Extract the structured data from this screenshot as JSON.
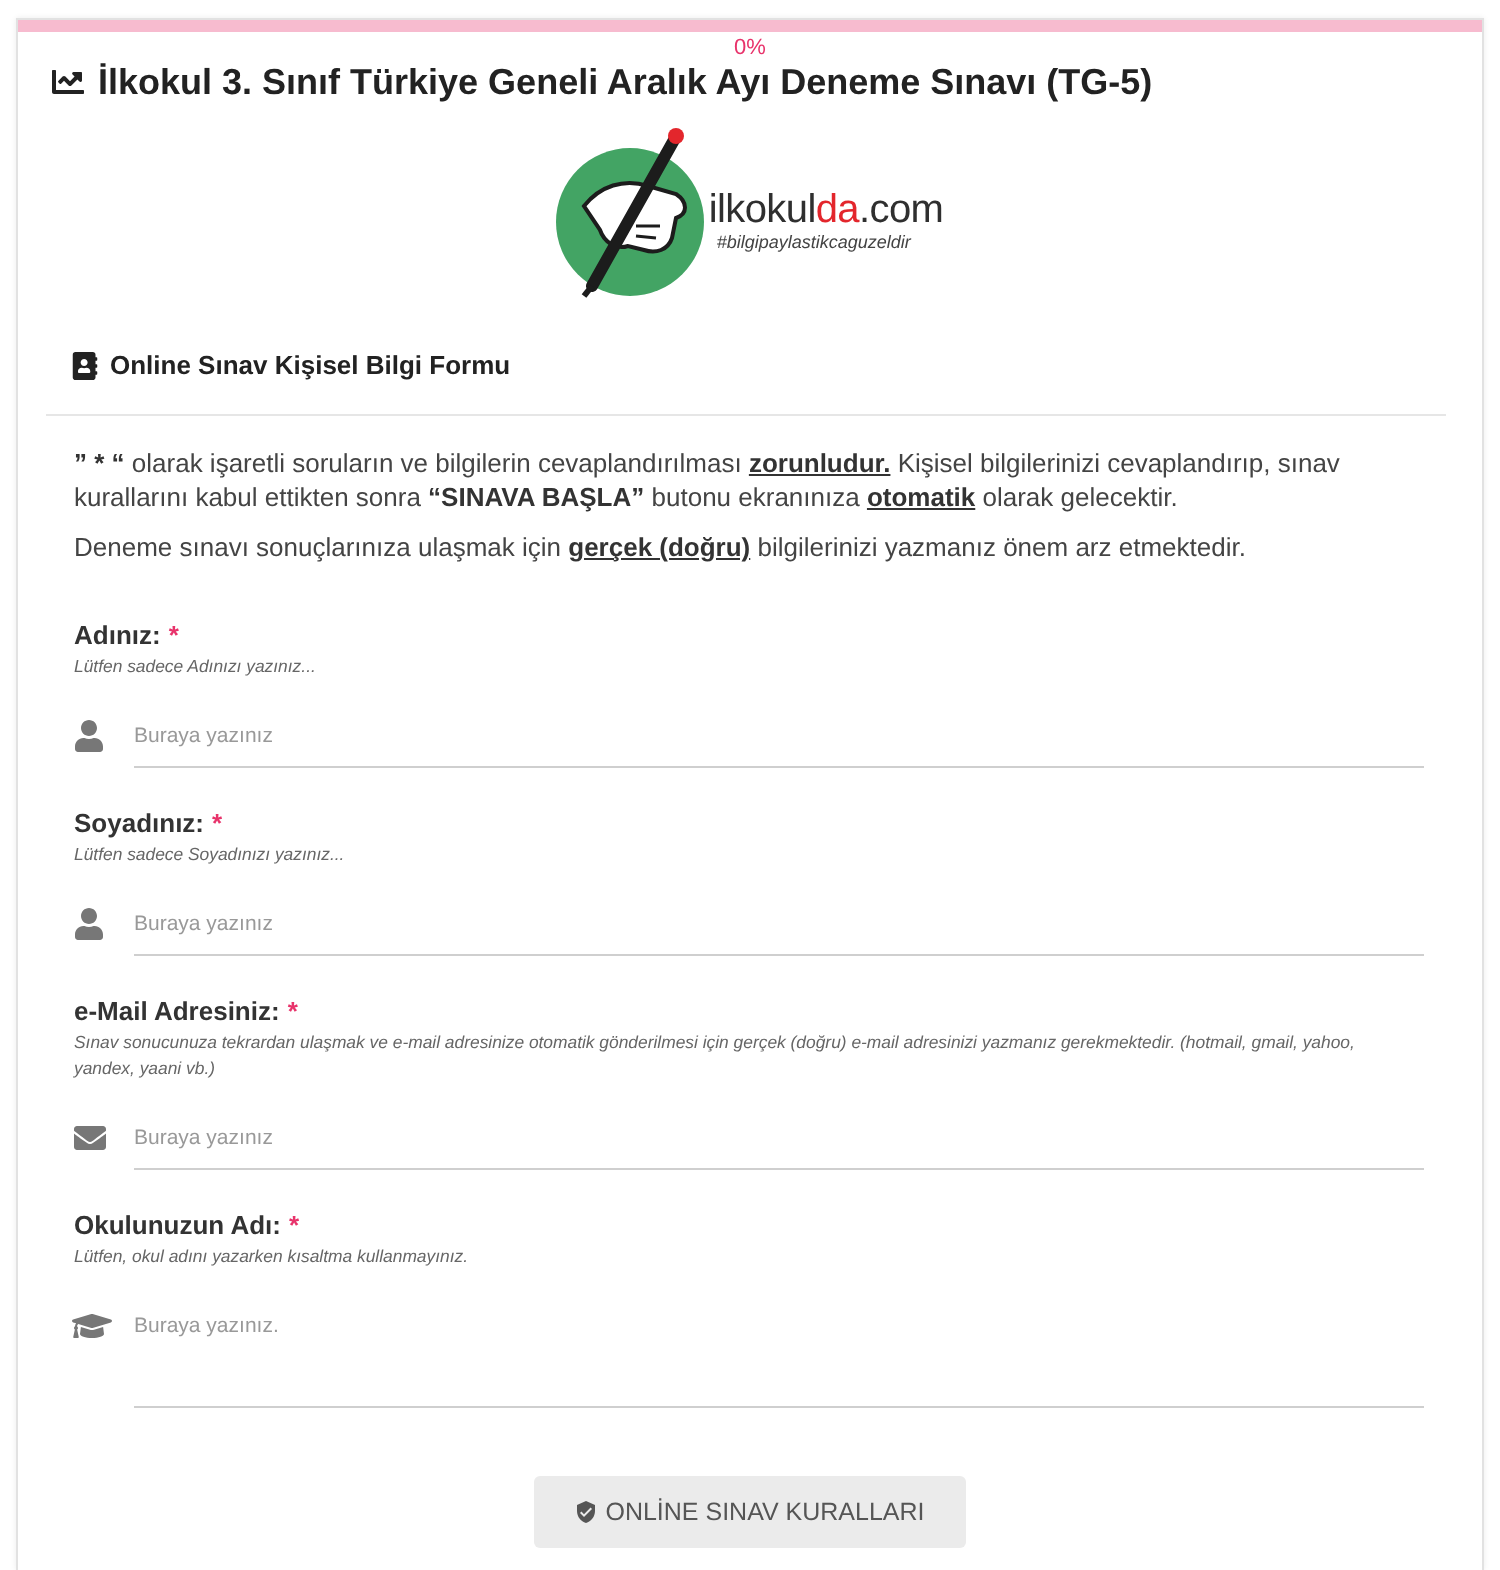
{
  "progress": {
    "level": 0,
    "label": "0%"
  },
  "title": "İlkokul 3. Sınıf Türkiye Geneli Aralık Ayı Deneme Sınavı (TG-5)",
  "logo": {
    "name": [
      {
        "text": "ilkokul",
        "accent": false
      },
      {
        "text": "da",
        "accent": true
      },
      {
        "text": ".com",
        "accent": false
      }
    ],
    "tagline": "#bilgipaylastikcaguzeldir"
  },
  "form": {
    "heading": "Online Sınav Kişisel Bilgi Formu",
    "intro": [
      [
        {
          "text": "” * “",
          "bold": true,
          "underline": false
        },
        {
          "text": " olarak işaretli soruların ve bilgilerin cevaplandırılması ",
          "bold": false,
          "underline": false
        },
        {
          "text": "zorunludur.",
          "bold": true,
          "underline": true
        },
        {
          "text": " Kişisel bilgilerinizi cevaplandırıp, sınav kurallarını kabul ettikten sonra ",
          "bold": false,
          "underline": false
        },
        {
          "text": "“SINAVA BAŞLA”",
          "bold": true,
          "underline": false
        },
        {
          "text": " butonu ekranınıza ",
          "bold": false,
          "underline": false
        },
        {
          "text": "otomatik",
          "bold": true,
          "underline": true
        },
        {
          "text": " olarak gelecektir.",
          "bold": false,
          "underline": false
        }
      ],
      [
        {
          "text": "Deneme sınavı sonuçlarınıza ulaşmak için ",
          "bold": false,
          "underline": false
        },
        {
          "text": "gerçek (doğru)",
          "bold": true,
          "underline": true
        },
        {
          "text": " bilgilerinizi yazmanız önem arz etmektedir.",
          "bold": false,
          "underline": false
        }
      ]
    ],
    "fields": [
      {
        "kind": "text",
        "label": "Adınız:",
        "required_mark": "*",
        "hint": "Lütfen sadece Adınızı yazınız...",
        "placeholder": "Buraya yazınız"
      },
      {
        "kind": "text",
        "label": "Soyadınız:",
        "required_mark": "*",
        "hint": "Lütfen sadece Soyadınızı yazınız...",
        "placeholder": "Buraya yazınız"
      },
      {
        "kind": "email",
        "label": "e-Mail Adresiniz:",
        "required_mark": "*",
        "hint": "Sınav sonucunuza tekrardan ulaşmak ve e-mail adresinize otomatik gönderilmesi için gerçek (doğru) e-mail adresinizi yazmanız gerekmektedir. (hotmail, gmail, yahoo, yandex, yaani vb.)",
        "placeholder": "Buraya yazınız"
      },
      {
        "kind": "textarea",
        "label": "Okulunuzun Adı:",
        "required_mark": "*",
        "hint": "Lütfen, okul adını yazarken kısaltma kullanmayınız.",
        "placeholder": "Buraya yazınız."
      }
    ],
    "button": "ONLİNE SINAV KURALLARI"
  }
}
